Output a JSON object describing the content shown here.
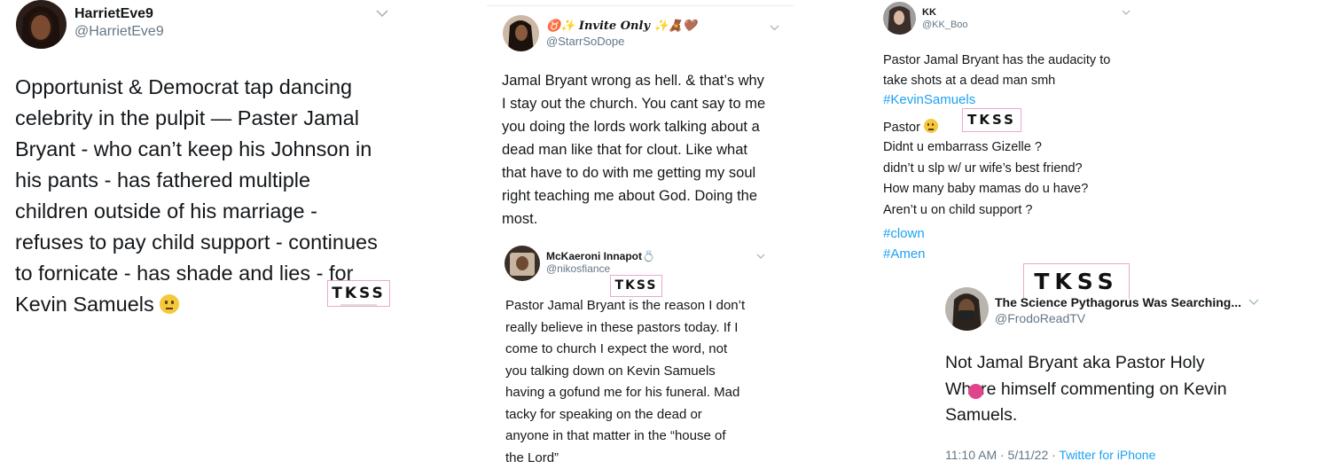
{
  "tweet1": {
    "name": "HarrietEve9",
    "handle": "@HarrietEve9",
    "lines": [
      "Opportunist & Democrat tap dancing",
      "celebrity in the pulpit — Paster Jamal",
      "Bryant - who can’t keep his Johnson in",
      "his pants - has fathered multiple",
      "children outside of his marriage -",
      "refuses to pay child support - continues",
      "to fornicate - has shade and lies - for",
      "Kevin Samuels"
    ],
    "emoji": "thinking-face"
  },
  "tweet2": {
    "name": "♉✨ Invite Only ✨🧸🤎",
    "handle": "@StarrSoDope",
    "body": "Jamal Bryant wrong as hell. & that’s why\nI stay out the church. You cant say to me\nyou doing the lords work talking about a\ndead man like that for clout. Like what\nthat have to do with me getting my soul\nright teaching me about God. Doing the\nmost."
  },
  "tweet3": {
    "name": "McKaeroni Innapot💍",
    "handle": "@nikosfiance",
    "body": "Pastor Jamal Bryant is the reason I don’t\nreally believe in these pastors today. If I\ncome to church I expect the word, not\nyou talking down on Kevin Samuels\nhaving a gofund me for his funeral. Mad\ntacky for speaking on the dead or\nanyone in that matter in the “house of\nthe Lord”"
  },
  "tweet4": {
    "name": "KK",
    "handle": "@KK_Boo",
    "intro": "Pastor Jamal Bryant has the audacity to\ntake shots at a dead man smh",
    "hashtag1": "#KevinSamuels",
    "pastor": "Pastor",
    "questions": "Didnt u embarrass Gizelle ?\ndidn’t u slp w/ ur wife’s best friend?\nHow many baby mamas do u have?\nAren’t u on child support ?",
    "hashtag2": "#clown",
    "hashtag3": "#Amen"
  },
  "tweet5": {
    "name": "The Science Pythagorus Was Searching...",
    "handle": "@FrodoReadTV",
    "body": "Not Jamal Bryant aka Pastor Holy\nWhore himself commenting on Kevin\nSamuels.",
    "time": "11:10 AM · 5/11/22 · ",
    "source": "Twitter for iPhone"
  },
  "watermark": {
    "text": "TKSS"
  },
  "colors": {
    "link": "#1da1f2",
    "secondary": "#657786",
    "watermark_border": "#e8a9cf",
    "dot": "#e0458b"
  }
}
